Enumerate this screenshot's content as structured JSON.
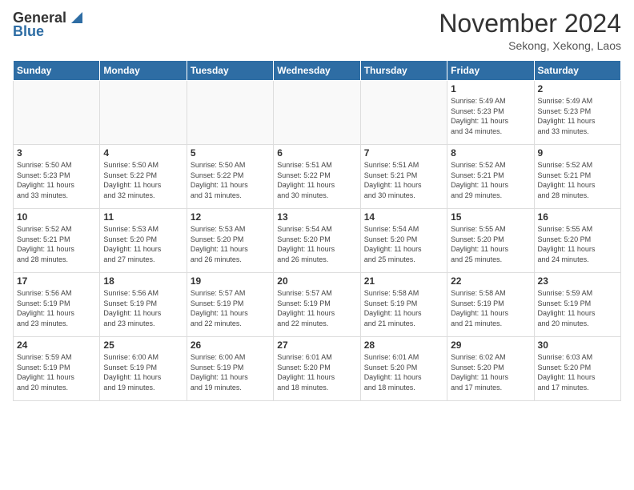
{
  "header": {
    "logo_general": "General",
    "logo_blue": "Blue",
    "month_title": "November 2024",
    "location": "Sekong, Xekong, Laos"
  },
  "weekdays": [
    "Sunday",
    "Monday",
    "Tuesday",
    "Wednesday",
    "Thursday",
    "Friday",
    "Saturday"
  ],
  "weeks": [
    [
      {
        "day": "",
        "info": ""
      },
      {
        "day": "",
        "info": ""
      },
      {
        "day": "",
        "info": ""
      },
      {
        "day": "",
        "info": ""
      },
      {
        "day": "",
        "info": ""
      },
      {
        "day": "1",
        "info": "Sunrise: 5:49 AM\nSunset: 5:23 PM\nDaylight: 11 hours\nand 34 minutes."
      },
      {
        "day": "2",
        "info": "Sunrise: 5:49 AM\nSunset: 5:23 PM\nDaylight: 11 hours\nand 33 minutes."
      }
    ],
    [
      {
        "day": "3",
        "info": "Sunrise: 5:50 AM\nSunset: 5:23 PM\nDaylight: 11 hours\nand 33 minutes."
      },
      {
        "day": "4",
        "info": "Sunrise: 5:50 AM\nSunset: 5:22 PM\nDaylight: 11 hours\nand 32 minutes."
      },
      {
        "day": "5",
        "info": "Sunrise: 5:50 AM\nSunset: 5:22 PM\nDaylight: 11 hours\nand 31 minutes."
      },
      {
        "day": "6",
        "info": "Sunrise: 5:51 AM\nSunset: 5:22 PM\nDaylight: 11 hours\nand 30 minutes."
      },
      {
        "day": "7",
        "info": "Sunrise: 5:51 AM\nSunset: 5:21 PM\nDaylight: 11 hours\nand 30 minutes."
      },
      {
        "day": "8",
        "info": "Sunrise: 5:52 AM\nSunset: 5:21 PM\nDaylight: 11 hours\nand 29 minutes."
      },
      {
        "day": "9",
        "info": "Sunrise: 5:52 AM\nSunset: 5:21 PM\nDaylight: 11 hours\nand 28 minutes."
      }
    ],
    [
      {
        "day": "10",
        "info": "Sunrise: 5:52 AM\nSunset: 5:21 PM\nDaylight: 11 hours\nand 28 minutes."
      },
      {
        "day": "11",
        "info": "Sunrise: 5:53 AM\nSunset: 5:20 PM\nDaylight: 11 hours\nand 27 minutes."
      },
      {
        "day": "12",
        "info": "Sunrise: 5:53 AM\nSunset: 5:20 PM\nDaylight: 11 hours\nand 26 minutes."
      },
      {
        "day": "13",
        "info": "Sunrise: 5:54 AM\nSunset: 5:20 PM\nDaylight: 11 hours\nand 26 minutes."
      },
      {
        "day": "14",
        "info": "Sunrise: 5:54 AM\nSunset: 5:20 PM\nDaylight: 11 hours\nand 25 minutes."
      },
      {
        "day": "15",
        "info": "Sunrise: 5:55 AM\nSunset: 5:20 PM\nDaylight: 11 hours\nand 25 minutes."
      },
      {
        "day": "16",
        "info": "Sunrise: 5:55 AM\nSunset: 5:20 PM\nDaylight: 11 hours\nand 24 minutes."
      }
    ],
    [
      {
        "day": "17",
        "info": "Sunrise: 5:56 AM\nSunset: 5:19 PM\nDaylight: 11 hours\nand 23 minutes."
      },
      {
        "day": "18",
        "info": "Sunrise: 5:56 AM\nSunset: 5:19 PM\nDaylight: 11 hours\nand 23 minutes."
      },
      {
        "day": "19",
        "info": "Sunrise: 5:57 AM\nSunset: 5:19 PM\nDaylight: 11 hours\nand 22 minutes."
      },
      {
        "day": "20",
        "info": "Sunrise: 5:57 AM\nSunset: 5:19 PM\nDaylight: 11 hours\nand 22 minutes."
      },
      {
        "day": "21",
        "info": "Sunrise: 5:58 AM\nSunset: 5:19 PM\nDaylight: 11 hours\nand 21 minutes."
      },
      {
        "day": "22",
        "info": "Sunrise: 5:58 AM\nSunset: 5:19 PM\nDaylight: 11 hours\nand 21 minutes."
      },
      {
        "day": "23",
        "info": "Sunrise: 5:59 AM\nSunset: 5:19 PM\nDaylight: 11 hours\nand 20 minutes."
      }
    ],
    [
      {
        "day": "24",
        "info": "Sunrise: 5:59 AM\nSunset: 5:19 PM\nDaylight: 11 hours\nand 20 minutes."
      },
      {
        "day": "25",
        "info": "Sunrise: 6:00 AM\nSunset: 5:19 PM\nDaylight: 11 hours\nand 19 minutes."
      },
      {
        "day": "26",
        "info": "Sunrise: 6:00 AM\nSunset: 5:19 PM\nDaylight: 11 hours\nand 19 minutes."
      },
      {
        "day": "27",
        "info": "Sunrise: 6:01 AM\nSunset: 5:20 PM\nDaylight: 11 hours\nand 18 minutes."
      },
      {
        "day": "28",
        "info": "Sunrise: 6:01 AM\nSunset: 5:20 PM\nDaylight: 11 hours\nand 18 minutes."
      },
      {
        "day": "29",
        "info": "Sunrise: 6:02 AM\nSunset: 5:20 PM\nDaylight: 11 hours\nand 17 minutes."
      },
      {
        "day": "30",
        "info": "Sunrise: 6:03 AM\nSunset: 5:20 PM\nDaylight: 11 hours\nand 17 minutes."
      }
    ]
  ]
}
